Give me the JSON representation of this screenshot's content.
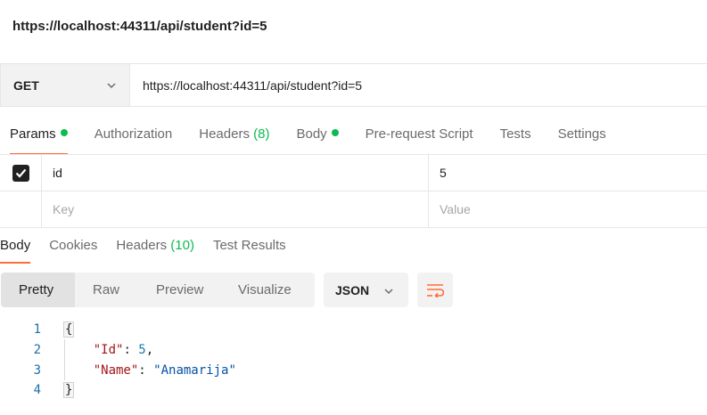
{
  "page_title": "https://localhost:44311/api/student?id=5",
  "request": {
    "method": "GET",
    "url": "https://localhost:44311/api/student?id=5"
  },
  "request_tabs": {
    "params": "Params",
    "authorization": "Authorization",
    "headers": "Headers",
    "headers_count": "(8)",
    "body": "Body",
    "pre_request": "Pre-request Script",
    "tests": "Tests",
    "settings": "Settings"
  },
  "params": {
    "rows": [
      {
        "key": "id",
        "value": "5",
        "checked": true
      }
    ],
    "key_placeholder": "Key",
    "value_placeholder": "Value"
  },
  "response_tabs": {
    "body": "Body",
    "cookies": "Cookies",
    "headers": "Headers",
    "headers_count": "(10)",
    "test_results": "Test Results"
  },
  "view_modes": {
    "pretty": "Pretty",
    "raw": "Raw",
    "preview": "Preview",
    "visualize": "Visualize"
  },
  "format": "JSON",
  "code": {
    "line_numbers": [
      "1",
      "2",
      "3",
      "4"
    ],
    "open_brace": "{",
    "close_brace": "}",
    "id_key": "\"Id\"",
    "id_value": "5",
    "name_key": "\"Name\"",
    "name_value": "\"Anamarija\""
  },
  "colors": {
    "accent": "#ff6c37",
    "status_green": "#0cbb52"
  },
  "icons": {
    "method_dropdown": "chevron-down-icon",
    "format_dropdown": "chevron-down-icon",
    "wrap": "wrap-lines-icon",
    "checkbox": "check-icon"
  }
}
